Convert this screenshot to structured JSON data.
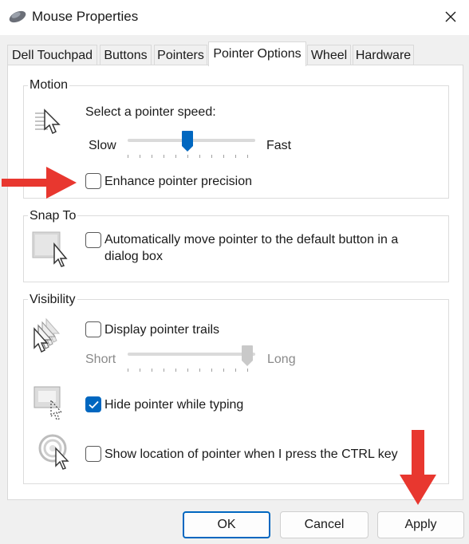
{
  "window": {
    "title": "Mouse Properties",
    "icon": "mouse-icon"
  },
  "tabs": [
    {
      "label": "Dell Touchpad",
      "active": false
    },
    {
      "label": "Buttons",
      "active": false
    },
    {
      "label": "Pointers",
      "active": false
    },
    {
      "label": "Pointer Options",
      "active": true
    },
    {
      "label": "Wheel",
      "active": false
    },
    {
      "label": "Hardware",
      "active": false
    }
  ],
  "motion": {
    "group_label": "Motion",
    "speed_label": "Select a pointer speed:",
    "slow_label": "Slow",
    "fast_label": "Fast",
    "speed_value_fraction": 0.5,
    "enhance_precision_label": "Enhance pointer precision",
    "enhance_precision_checked": false
  },
  "snap_to": {
    "group_label": "Snap To",
    "auto_move_label_line1": "Automatically move pointer to the default button in a",
    "auto_move_label_line2": "dialog box",
    "auto_move_checked": false
  },
  "visibility": {
    "group_label": "Visibility",
    "trails_label": "Display pointer trails",
    "trails_checked": false,
    "short_label": "Short",
    "long_label": "Long",
    "trails_length_fraction": 1.0,
    "hide_typing_label": "Hide pointer while typing",
    "hide_typing_checked": true,
    "show_location_label": "Show location of pointer when I press the CTRL key",
    "show_location_checked": false
  },
  "buttons": {
    "ok": "OK",
    "cancel": "Cancel",
    "apply": "Apply"
  },
  "colors": {
    "accent": "#0067c0",
    "annotation_arrow": "#e8372f"
  }
}
